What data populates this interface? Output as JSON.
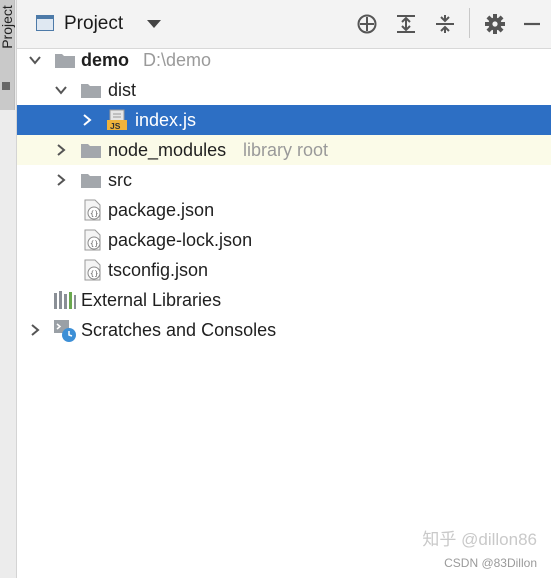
{
  "sidebar": {
    "tab_label": "Project"
  },
  "header": {
    "title": "Project",
    "actions": [
      "locate-icon",
      "expand-all-icon",
      "collapse-all-icon",
      "gear-icon",
      "hide-icon"
    ]
  },
  "tree": {
    "root": {
      "name": "demo",
      "path": "D:\\demo"
    },
    "dist": {
      "name": "dist"
    },
    "index_js": {
      "name": "index.js",
      "badge": "JS"
    },
    "node_modules": {
      "name": "node_modules",
      "note": "library root"
    },
    "src": {
      "name": "src"
    },
    "package_json": {
      "name": "package.json"
    },
    "package_lock": {
      "name": "package-lock.json"
    },
    "tsconfig": {
      "name": "tsconfig.json"
    },
    "external": {
      "name": "External Libraries"
    },
    "scratches": {
      "name": "Scratches and Consoles"
    }
  },
  "watermark": {
    "line1": "知乎 @dillon86",
    "line2": "CSDN @83Dillon"
  },
  "colors": {
    "selection": "#2d6fc4",
    "folder": "#a3a7ac",
    "hover_row": "#fbfbe8"
  }
}
